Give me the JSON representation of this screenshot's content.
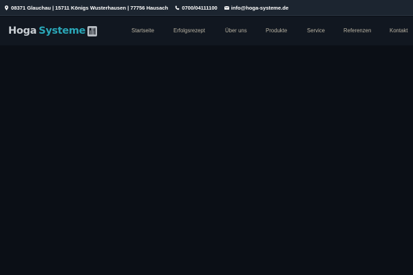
{
  "topbar": {
    "address": "08371 Glauchau | 15711 Königs Wusterhausen | 77756 Hausach",
    "phone": "0700/04111100",
    "email": "info@hoga-systeme.de",
    "icons": [
      "map-pin-icon",
      "phone-icon",
      "envelope-icon"
    ]
  },
  "logo": {
    "part1": "Hoga",
    "part2": "Systeme",
    "icon": "cutlery-icon"
  },
  "nav": {
    "items": [
      {
        "label": "Startseite"
      },
      {
        "label": "Erfolgsrezept"
      },
      {
        "label": "Über uns"
      },
      {
        "label": "Produkte"
      },
      {
        "label": "Service"
      },
      {
        "label": "Referenzen"
      },
      {
        "label": "Kontakt"
      }
    ]
  },
  "colors": {
    "background": "#0b0f16",
    "topbar": "#1c2530",
    "header": "#111720",
    "logo_gray": "#c9ced3",
    "logo_teal": "#2aa7b8",
    "nav_text": "#b8b2a2"
  }
}
